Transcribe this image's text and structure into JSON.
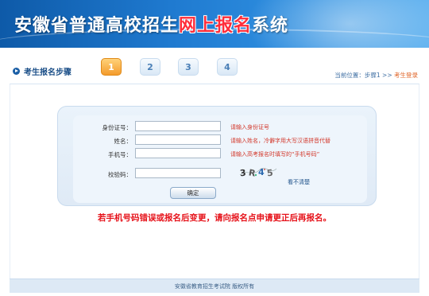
{
  "header": {
    "title_main": "安徽省普通高校招生",
    "title_accent": "网上报名",
    "title_tail": "系统"
  },
  "steps": {
    "label": "考生报名步骤",
    "items": [
      "1",
      "2",
      "3",
      "4"
    ],
    "active_index": 0,
    "breadcrumb_prefix": "当前位置：步骤1 >> ",
    "breadcrumb_current": "考生登录"
  },
  "form": {
    "id_label": "身份证号：",
    "id_value": "",
    "id_hint": "请输入身份证号",
    "name_label": "姓名：",
    "name_value": "",
    "name_hint": "请输入姓名，冷僻字用大写汉语拼音代替",
    "phone_label": "手机号：",
    "phone_value": "",
    "phone_hint": "请输入高考报名时填写的“手机号码”",
    "captcha_label": "校验码：",
    "captcha_value": "",
    "captcha_text": "3R45",
    "captcha_refresh": "看不清楚",
    "submit_label": "确定"
  },
  "notice": "若手机号码错误或报名后变更，请向报名点申请更正后再报名。",
  "footer": "安徽省教育招生考试院 版权所有",
  "colors": {
    "banner": "#1f7ad0",
    "accent_red": "#ff2d3a",
    "active_step": "#f49b2c",
    "hint_red": "#d3382b",
    "warning_red": "#e6121a"
  }
}
